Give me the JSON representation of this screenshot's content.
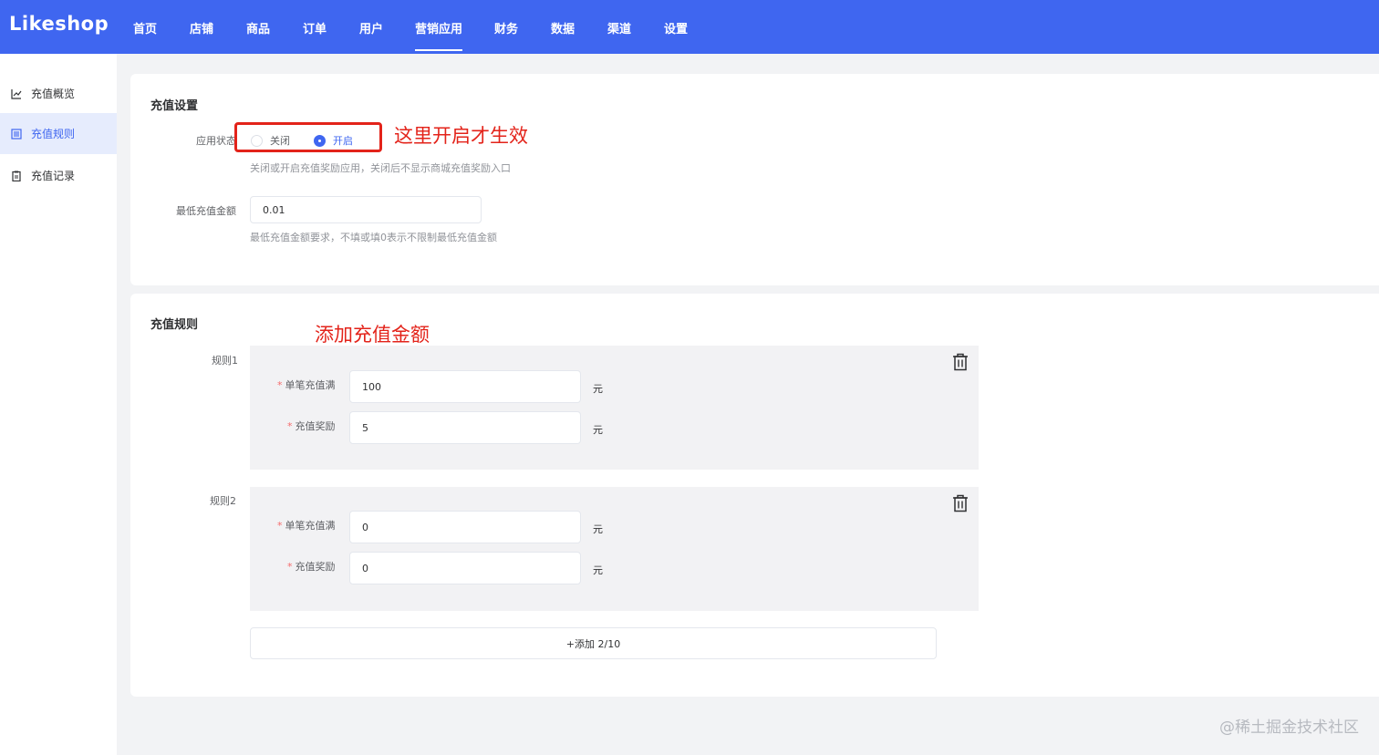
{
  "app": {
    "logo": "Likeshop"
  },
  "topnav": {
    "items": [
      {
        "label": "首页"
      },
      {
        "label": "店铺"
      },
      {
        "label": "商品"
      },
      {
        "label": "订单"
      },
      {
        "label": "用户"
      },
      {
        "label": "营销应用",
        "active": true
      },
      {
        "label": "财务"
      },
      {
        "label": "数据"
      },
      {
        "label": "渠道"
      },
      {
        "label": "设置"
      }
    ]
  },
  "sidebar": {
    "items": [
      {
        "label": "充值概览",
        "icon": "chart-icon"
      },
      {
        "label": "充值规则",
        "icon": "list-icon",
        "active": true
      },
      {
        "label": "充值记录",
        "icon": "clipboard-icon"
      }
    ]
  },
  "settings": {
    "title": "充值设置",
    "status_label": "应用状态",
    "status_options": [
      "关闭",
      "开启"
    ],
    "status_selected": "开启",
    "status_hint": "关闭或开启充值奖励应用，关闭后不显示商城充值奖励入口",
    "min_label": "最低充值金额",
    "min_value": "0.01",
    "min_hint": "最低充值金额要求，不填或填0表示不限制最低充值金额"
  },
  "rules": {
    "title": "充值规则",
    "items": [
      {
        "name": "规则1",
        "threshold_label": "单笔充值满",
        "threshold_value": "100",
        "reward_label": "充值奖励",
        "reward_value": "5",
        "unit": "元"
      },
      {
        "name": "规则2",
        "threshold_label": "单笔充值满",
        "threshold_value": "0",
        "reward_label": "充值奖励",
        "reward_value": "0",
        "unit": "元"
      }
    ],
    "add_label": "+添加 2/10"
  },
  "annotations": {
    "status_note": "这里开启才生效",
    "rule_note": "添加充值金额"
  },
  "watermark": "@稀土掘金技术社区",
  "colors": {
    "primary": "#3f66f0",
    "annotation": "#e3231a"
  }
}
